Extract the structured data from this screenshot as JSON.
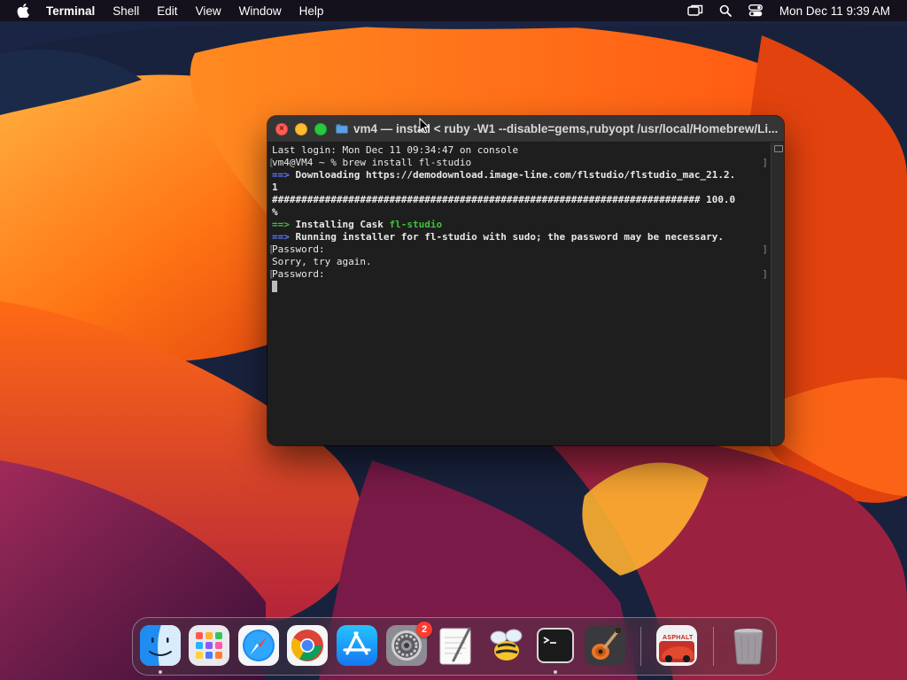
{
  "menubar": {
    "app_name": "Terminal",
    "menus": [
      "Shell",
      "Edit",
      "View",
      "Window",
      "Help"
    ],
    "clock": "Mon Dec 11  9:39 AM",
    "status_icons": [
      "screen-mirroring-icon",
      "spotlight-search-icon",
      "control-center-icon"
    ]
  },
  "terminal": {
    "title": "vm4 — install < ruby -W1 --disable=gems,rubyopt /usr/local/Homebrew/Li...",
    "lines": {
      "l1": "Last login: Mon Dec 11 09:34:47 on console",
      "l2": "vm4@VM4 ~ % brew install fl-studio",
      "l3_arrow": "==>",
      "l3_text": " Downloading https://demodownload.image-line.com/flstudio/flstudio_mac_21.2.",
      "l4": "1",
      "l5": "######################################################################### 100.0",
      "l6": "%",
      "l7_arrow": "==>",
      "l7_text": " Installing Cask ",
      "l7_cask": "fl-studio",
      "l8_arrow": "==>",
      "l8_text": " Running installer for fl-studio with sudo; the password may be necessary.",
      "l9": "Password:",
      "l10": "Sorry, try again.",
      "l11": "Password:"
    }
  },
  "dock": {
    "apps": [
      {
        "name": "Finder",
        "icon": "finder-icon",
        "running": true
      },
      {
        "name": "Launchpad",
        "icon": "launchpad-icon",
        "running": false
      },
      {
        "name": "Safari",
        "icon": "safari-icon",
        "running": false
      },
      {
        "name": "Google Chrome",
        "icon": "chrome-icon",
        "running": false
      },
      {
        "name": "App Store",
        "icon": "app-store-icon",
        "running": false
      },
      {
        "name": "System Settings",
        "icon": "settings-icon",
        "running": false,
        "badge": "2"
      },
      {
        "name": "TextEdit",
        "icon": "textedit-icon",
        "running": false
      },
      {
        "name": "Bee",
        "icon": "bee-icon",
        "running": false
      },
      {
        "name": "Terminal",
        "icon": "terminal-icon",
        "running": true
      },
      {
        "name": "GarageBand",
        "icon": "garageband-icon",
        "running": false
      },
      {
        "name": "Asphalt",
        "icon": "asphalt-icon",
        "running": false,
        "label": "ASPHALT"
      },
      {
        "name": "Trash",
        "icon": "trash-icon",
        "running": false
      }
    ]
  },
  "colors": {
    "terminal_bg": "#1e1e1e",
    "arrow_blue": "#5b7cff",
    "arrow_green": "#3ec23e",
    "close": "#ff5f57",
    "minimize": "#febc2e",
    "maximize": "#28c840"
  }
}
